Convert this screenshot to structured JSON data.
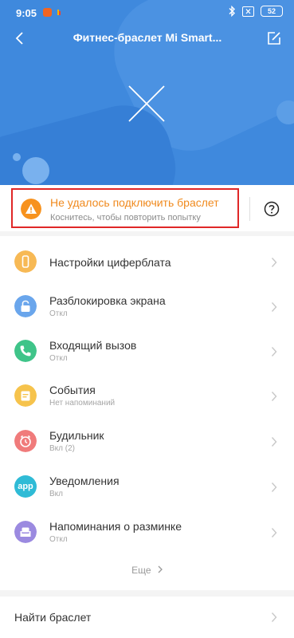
{
  "status_bar": {
    "time": "9:05",
    "battery": "52"
  },
  "toolbar": {
    "title": "Фитнес-браслет Mi Smart..."
  },
  "banner": {
    "title": "Не удалось подключить браслет",
    "subtitle": "Коснитесь, чтобы повторить попытку"
  },
  "menu": {
    "items": [
      {
        "title": "Настройки циферблата",
        "subtitle": "",
        "icon": "watch-face-icon",
        "color": "#f7b955"
      },
      {
        "title": "Разблокировка экрана",
        "subtitle": "Откл",
        "icon": "unlock-icon",
        "color": "#6aa6ec"
      },
      {
        "title": "Входящий вызов",
        "subtitle": "Откл",
        "icon": "phone-icon",
        "color": "#3fc489"
      },
      {
        "title": "События",
        "subtitle": "Нет напоминаний",
        "icon": "calendar-icon",
        "color": "#f6c34c"
      },
      {
        "title": "Будильник",
        "subtitle": "Вкл (2)",
        "icon": "alarm-icon",
        "color": "#f07b7b"
      },
      {
        "title": "Уведомления",
        "subtitle": "Вкл",
        "icon": "app-icon",
        "color": "#2fbbd6",
        "icon_text": "app"
      },
      {
        "title": "Напоминания о разминке",
        "subtitle": "Откл",
        "icon": "sofa-icon",
        "color": "#9b8ae0"
      }
    ],
    "more_label": "Еще"
  },
  "find": {
    "label": "Найти браслет"
  },
  "colors": {
    "header_bg": "#3f89dd",
    "accent_orange": "#f08a1e",
    "highlight_red": "#e02727"
  }
}
